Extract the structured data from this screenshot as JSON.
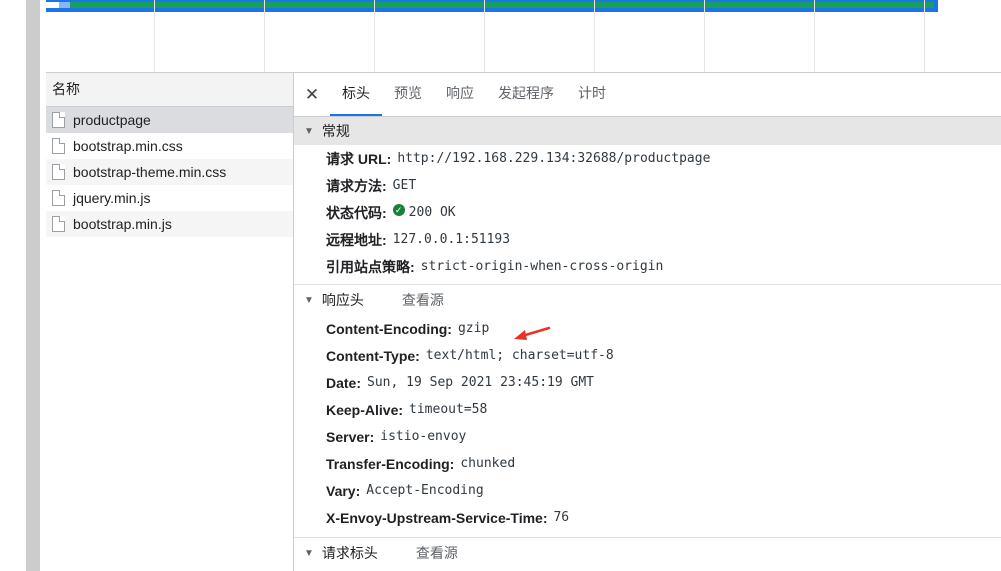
{
  "name_panel": {
    "header": "名称",
    "files": [
      {
        "name": "productpage"
      },
      {
        "name": "bootstrap.min.css"
      },
      {
        "name": "bootstrap-theme.min.css"
      },
      {
        "name": "jquery.min.js"
      },
      {
        "name": "bootstrap.min.js"
      }
    ]
  },
  "tabs": {
    "close": "✕",
    "items": [
      "标头",
      "预览",
      "响应",
      "发起程序",
      "计时"
    ]
  },
  "general": {
    "title": "常规",
    "rows": [
      {
        "key": "请求 URL:",
        "value": "http://192.168.229.134:32688/productpage"
      },
      {
        "key": "请求方法:",
        "value": "GET"
      },
      {
        "key": "状态代码:",
        "value": "200 OK"
      },
      {
        "key": "远程地址:",
        "value": "127.0.0.1:51193"
      },
      {
        "key": "引用站点策略:",
        "value": "strict-origin-when-cross-origin"
      }
    ]
  },
  "response_headers": {
    "title": "响应头",
    "view_source": "查看源",
    "rows": [
      {
        "key": "Content-Encoding:",
        "value": "gzip"
      },
      {
        "key": "Content-Type:",
        "value": "text/html; charset=utf-8"
      },
      {
        "key": "Date:",
        "value": "Sun, 19 Sep 2021 23:45:19 GMT"
      },
      {
        "key": "Keep-Alive:",
        "value": "timeout=58"
      },
      {
        "key": "Server:",
        "value": "istio-envoy"
      },
      {
        "key": "Transfer-Encoding:",
        "value": "chunked"
      },
      {
        "key": "Vary:",
        "value": "Accept-Encoding"
      },
      {
        "key": "X-Envoy-Upstream-Service-Time:",
        "value": "76"
      }
    ]
  },
  "request_headers": {
    "title": "请求标头",
    "view_source": "查看源"
  },
  "colors": {
    "accent": "#1a73e8",
    "status_ok": "#188038",
    "annotation_arrow": "#e8322a"
  },
  "icons": {
    "status": "check-circle-icon",
    "file": "document-icon",
    "collapse": "triangle-down-icon"
  }
}
